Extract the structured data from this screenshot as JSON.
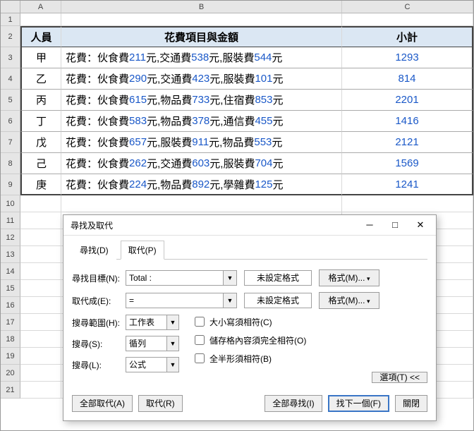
{
  "columns": {
    "A": "A",
    "B": "B",
    "C": "C"
  },
  "rowCount": 21,
  "colWidths": {
    "A": 58,
    "B": 398,
    "C": 186
  },
  "table": {
    "headers": {
      "A": "人員",
      "B": "花費項目與金額",
      "C": "小計"
    },
    "rows": [
      {
        "person": "甲",
        "prefix": "花費：",
        "items": [
          [
            "伙食費",
            "211",
            "元, "
          ],
          [
            "交通費",
            "538",
            "元, "
          ],
          [
            "服裝費",
            "544",
            "元"
          ]
        ],
        "subtotal": "1293"
      },
      {
        "person": "乙",
        "prefix": "花費：",
        "items": [
          [
            "伙食費",
            "290",
            "元, "
          ],
          [
            "交通費",
            "423",
            "元, "
          ],
          [
            "服裝費",
            "101",
            "元"
          ]
        ],
        "subtotal": "814"
      },
      {
        "person": "丙",
        "prefix": "花費：",
        "items": [
          [
            "伙食費",
            "615",
            "元, "
          ],
          [
            "物品費",
            "733",
            "元, "
          ],
          [
            "住宿費",
            "853",
            "元"
          ]
        ],
        "subtotal": "2201"
      },
      {
        "person": "丁",
        "prefix": "花費：",
        "items": [
          [
            "伙食費",
            "583",
            "元, "
          ],
          [
            "物品費",
            "378",
            "元, "
          ],
          [
            "通信費",
            "455",
            "元"
          ]
        ],
        "subtotal": "1416"
      },
      {
        "person": "戊",
        "prefix": "花費：",
        "items": [
          [
            "伙食費",
            "657",
            "元, "
          ],
          [
            "服裝費",
            "911",
            "元, "
          ],
          [
            "物品費",
            "553",
            "元"
          ]
        ],
        "subtotal": "2121"
      },
      {
        "person": "己",
        "prefix": "花費：",
        "items": [
          [
            "伙食費",
            "262",
            "元, "
          ],
          [
            "交通費",
            "603",
            "元, "
          ],
          [
            "服裝費",
            "704",
            "元"
          ]
        ],
        "subtotal": "1569"
      },
      {
        "person": "庚",
        "prefix": "花費：",
        "items": [
          [
            "伙食費",
            "224",
            "元, "
          ],
          [
            "物品費",
            "892",
            "元, "
          ],
          [
            "學雜費",
            "125",
            "元"
          ]
        ],
        "subtotal": "1241"
      }
    ]
  },
  "dialog": {
    "title": "尋找及取代",
    "tabs": {
      "find": "尋找(D)",
      "replace": "取代(P)"
    },
    "find": {
      "label": "尋找目標(N):",
      "value": "Total :",
      "format_none": "未設定格式",
      "format_btn": "格式(M)..."
    },
    "replace": {
      "label": "取代成(E):",
      "value": "=",
      "format_none": "未設定格式",
      "format_btn": "格式(M)..."
    },
    "scope": {
      "range_label": "搜尋範圍(H):",
      "range_value": "工作表",
      "search_label": "搜尋(S):",
      "search_value": "循列",
      "lookin_label": "搜尋(L):",
      "lookin_value": "公式"
    },
    "checks": {
      "case": "大小寫須相符(C)",
      "entire": "儲存格內容須完全相符(O)",
      "width": "全半形須相符(B)"
    },
    "options_btn": "選項(T) <<",
    "buttons": {
      "replace_all": "全部取代(A)",
      "replace": "取代(R)",
      "find_all": "全部尋找(I)",
      "find_next": "找下一個(F)",
      "close": "關閉"
    }
  }
}
